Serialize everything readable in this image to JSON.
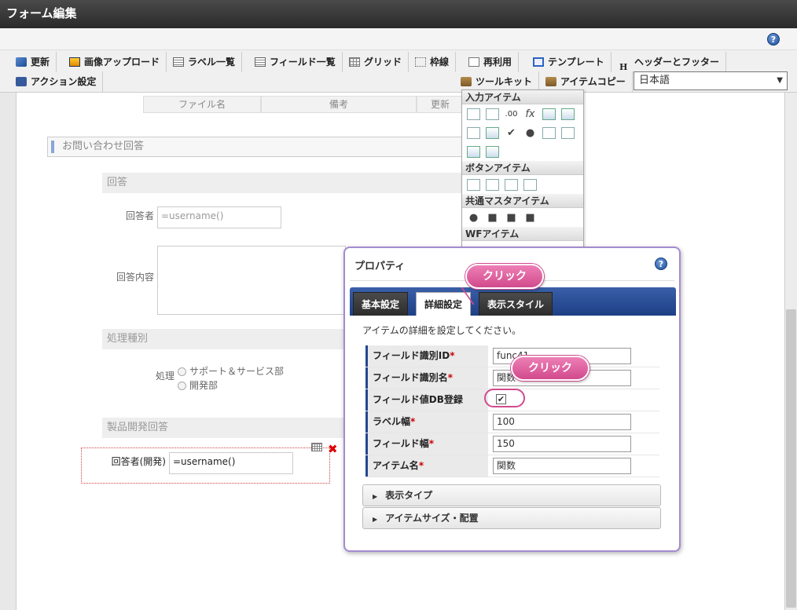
{
  "window": {
    "title": "フォーム編集"
  },
  "toolbar": {
    "row1": [
      "更新",
      "画像アップロード",
      "ラベル一覧",
      "フィールド一覧",
      "グリッド",
      "枠線",
      "再利用",
      "テンプレート",
      "ヘッダーとフッター"
    ],
    "row2": {
      "action": "アクション設定",
      "toolkit": "ツールキット",
      "itemcopy": "アイテムコピー"
    },
    "language": "日本語",
    "h_glyph": "H"
  },
  "grid_headers": [
    "ファイル名",
    "備考",
    "更新"
  ],
  "form": {
    "section_title": "お問い合わせ回答",
    "sub_answer": "回答",
    "answerer_label": "回答者",
    "answerer_value": "=username()",
    "content_label": "回答内容",
    "sub_process": "処理種別",
    "process_label": "処理",
    "process_options": [
      "サポート＆サービス部",
      "開発部"
    ],
    "sub_product": "製品開発回答",
    "dev_label": "回答者(開発)",
    "dev_value": "=username()"
  },
  "palette": {
    "input_items": "入力アイテム",
    "button_items": "ボタンアイテム",
    "master_items": "共通マスタアイテム",
    "wf_items": "WFアイテム",
    "fx": "fx",
    "num": ".00"
  },
  "properties": {
    "title": "プロパティ",
    "tabs": [
      "基本設定",
      "詳細設定",
      "表示スタイル"
    ],
    "description": "アイテムの詳細を設定してください。",
    "rows": [
      {
        "label": "フィールド識別ID",
        "value": "func41"
      },
      {
        "label": "フィールド識別名",
        "value": "関数"
      },
      {
        "label": "フィールド値DB登録",
        "value": ""
      },
      {
        "label": "ラベル幅",
        "value": "100"
      },
      {
        "label": "フィールド幅",
        "value": "150"
      },
      {
        "label": "アイテム名",
        "value": "関数"
      }
    ],
    "checkbox_checked": true,
    "required_mark": "*",
    "accordions": [
      "表示タイプ",
      "アイテムサイズ・配置"
    ]
  },
  "callouts": {
    "tab": "クリック",
    "checkbox": "クリック"
  },
  "icons": {
    "help": "?",
    "close": "✖",
    "check": "✔",
    "dropdown": "▼",
    "triangle": "▶"
  },
  "colors": {
    "accent": "#1d3f86",
    "callout": "#d14a8d",
    "required": "#cc0000"
  }
}
